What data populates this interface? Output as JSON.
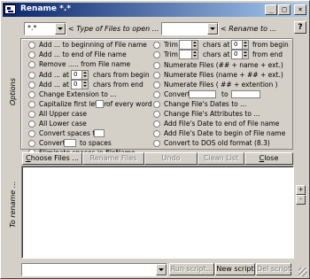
{
  "window": {
    "title": "Rename  *.*"
  },
  "titlebar_buttons": {
    "minimize": "_",
    "maximize": "□",
    "close": "×"
  },
  "filter": {
    "value": "*.*",
    "label": "< Type of Files to open ..."
  },
  "rename_to": {
    "value": "",
    "label": "< Rename to ..."
  },
  "help_label": "?",
  "options_label": "Options",
  "rename_label": "To rename ...",
  "left_options": [
    "Add ... to beginning of File name",
    "Add ... to end of File name",
    "Remove ..... from File name",
    "Add ... at",
    "Add ... at",
    "Change Extension to ...",
    "Capitalize first letter",
    "All Upper case",
    "All Lower case",
    "Convert spaces to",
    "Convert",
    "Eliminate spaces in fileName"
  ],
  "left_extras": {
    "chars_from_begin": "chars from begin",
    "chars_from_end": "chars from  end",
    "of_every_word": "of every word",
    "to_spaces": "to spaces",
    "spin1": "0",
    "spin2": "0"
  },
  "right_options": [
    "Trim",
    "Trim",
    "Numerate Files (## + name + ext.)",
    "Numerate Files (name + ## + ext.)",
    "Numerate Files ( ## + extention )",
    "Convert",
    "Change File's Dates to ...",
    "Change File's Attributes to ...",
    "Add File's Date to end of File name",
    "Add File's Date to begin of File name",
    "Convert to DOS old format  (8.3)"
  ],
  "right_extras": {
    "chars_at": "chars at",
    "from_begin": "from begin",
    "from_end": "from  end",
    "to": "to",
    "trim_spin1": "0",
    "trim_spin2": "0"
  },
  "buttons": {
    "choose": "Choose Files ...",
    "rename": "Rename Files",
    "undo": "Undo",
    "clear": "Clean List",
    "close": "Close"
  },
  "bottom": {
    "script_value": "",
    "run": "Run script...",
    "new": "New script",
    "del": "Del script"
  },
  "side_arrows": {
    "up": "+",
    "down": "-"
  }
}
